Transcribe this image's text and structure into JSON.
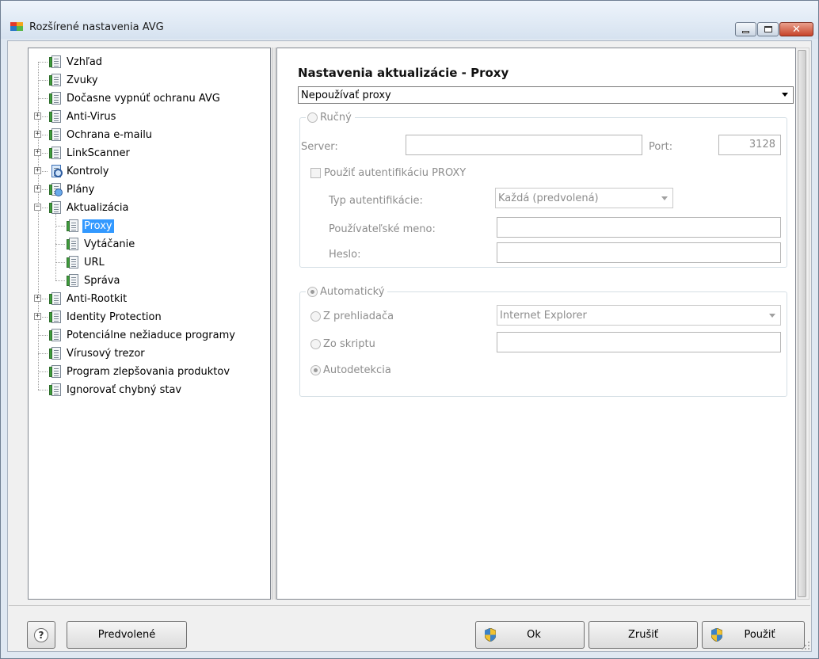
{
  "window": {
    "title": "Rozšírené nastavenia AVG"
  },
  "tree": [
    {
      "label": "Vzhľad",
      "level": 0,
      "expander": "",
      "icon": "doc-icon",
      "selected": false
    },
    {
      "label": "Zvuky",
      "level": 0,
      "expander": "",
      "icon": "doc-icon",
      "selected": false
    },
    {
      "label": "Dočasne vypnúť ochranu AVG",
      "level": 0,
      "expander": "",
      "icon": "doc-icon",
      "selected": false
    },
    {
      "label": "Anti-Virus",
      "level": 0,
      "expander": "+",
      "icon": "doc-icon",
      "selected": false
    },
    {
      "label": "Ochrana e-mailu",
      "level": 0,
      "expander": "+",
      "icon": "doc-icon",
      "selected": false
    },
    {
      "label": "LinkScanner",
      "level": 0,
      "expander": "+",
      "icon": "doc-icon",
      "selected": false
    },
    {
      "label": "Kontroly",
      "level": 0,
      "expander": "+",
      "icon": "search-icon",
      "selected": false
    },
    {
      "label": "Plány",
      "level": 0,
      "expander": "+",
      "icon": "schedule-icon",
      "selected": false
    },
    {
      "label": "Aktualizácia",
      "level": 0,
      "expander": "−",
      "icon": "doc-icon",
      "selected": false
    },
    {
      "label": "Proxy",
      "level": 1,
      "expander": "",
      "icon": "doc-icon",
      "selected": true
    },
    {
      "label": "Vytáčanie",
      "level": 1,
      "expander": "",
      "icon": "doc-icon",
      "selected": false
    },
    {
      "label": "URL",
      "level": 1,
      "expander": "",
      "icon": "doc-icon",
      "selected": false
    },
    {
      "label": "Správa",
      "level": 1,
      "expander": "",
      "icon": "doc-icon",
      "selected": false
    },
    {
      "label": "Anti-Rootkit",
      "level": 0,
      "expander": "+",
      "icon": "doc-icon",
      "selected": false
    },
    {
      "label": "Identity Protection",
      "level": 0,
      "expander": "+",
      "icon": "doc-icon",
      "selected": false
    },
    {
      "label": "Potenciálne nežiaduce programy",
      "level": 0,
      "expander": "",
      "icon": "doc-icon",
      "selected": false
    },
    {
      "label": "Vírusový trezor",
      "level": 0,
      "expander": "",
      "icon": "doc-icon",
      "selected": false
    },
    {
      "label": "Program zlepšovania produktov",
      "level": 0,
      "expander": "",
      "icon": "doc-icon",
      "selected": false
    },
    {
      "label": "Ignorovať chybný stav",
      "level": 0,
      "expander": "",
      "icon": "doc-icon",
      "selected": false
    }
  ],
  "main": {
    "title": "Nastavenia aktualizácie - Proxy",
    "proxy_mode": "Nepoužívať proxy",
    "manual": {
      "legend": "Ručný",
      "server_label": "Server:",
      "server_value": "",
      "port_label": "Port:",
      "port_value": "3128",
      "use_auth_label": "Použiť autentifikáciu PROXY",
      "auth_type_label": "Typ autentifikácie:",
      "auth_type_value": "Každá (predvolená)",
      "username_label": "Používateľské meno:",
      "username_value": "",
      "password_label": "Heslo:",
      "password_value": ""
    },
    "automatic": {
      "legend": "Automatický",
      "from_browser_label": "Z prehliadača",
      "browser_value": "Internet Explorer",
      "from_script_label": "Zo skriptu",
      "script_value": "",
      "autodetect_label": "Autodetekcia"
    }
  },
  "footer": {
    "help_glyph": "?",
    "defaults_label": "Predvolené",
    "ok_label": "Ok",
    "cancel_label": "Zrušiť",
    "apply_label": "Použiť"
  }
}
